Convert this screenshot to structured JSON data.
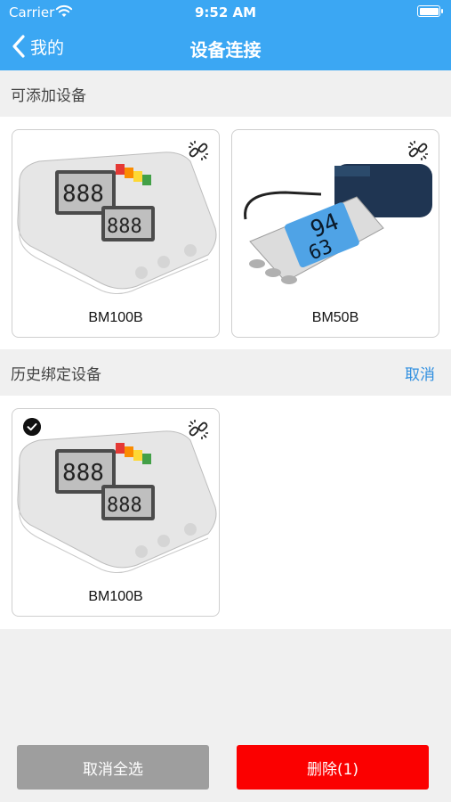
{
  "status_bar": {
    "carrier": "Carrier",
    "time": "9:52 AM"
  },
  "nav": {
    "back_label": "我的",
    "title": "设备连接"
  },
  "available_section": {
    "title": "可添加设备",
    "devices": [
      {
        "name": "BM100B"
      },
      {
        "name": "BM50B"
      }
    ]
  },
  "history_section": {
    "title": "历史绑定设备",
    "action_label": "取消",
    "devices": [
      {
        "name": "BM100B",
        "selected": true
      }
    ]
  },
  "footer": {
    "cancel_all_label": "取消全选",
    "delete_label": "删除(1)"
  },
  "colors": {
    "header": "#3ba7f3",
    "accent": "#2f8fe0",
    "delete": "#fb0000",
    "disabled": "#9e9e9e"
  }
}
